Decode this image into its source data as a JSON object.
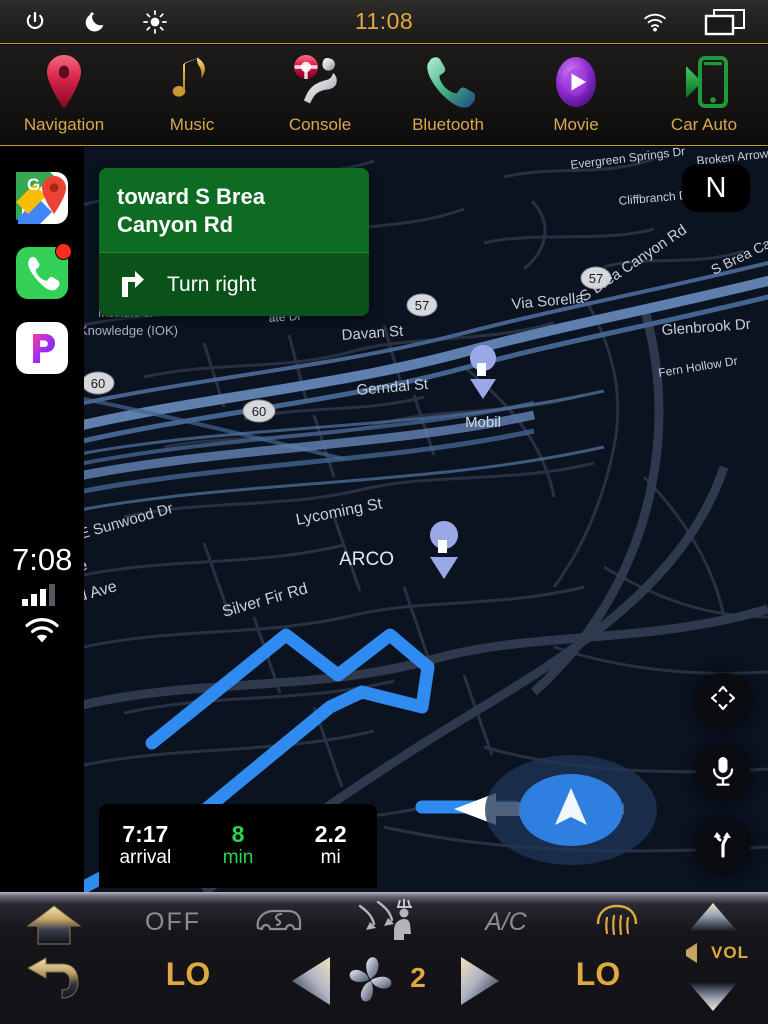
{
  "statusbar": {
    "clock": "11:08",
    "left_icons": [
      {
        "name": "power-icon"
      },
      {
        "name": "night-mode-icon"
      },
      {
        "name": "brightness-icon"
      }
    ],
    "right_icons": [
      {
        "name": "wifi-icon"
      },
      {
        "name": "multi-window-icon"
      }
    ]
  },
  "tabs": [
    {
      "label": "Navigation",
      "icon": "map-pin-icon"
    },
    {
      "label": "Music",
      "icon": "music-note-icon"
    },
    {
      "label": "Console",
      "icon": "steering-wheel-seat-icon"
    },
    {
      "label": "Bluetooth",
      "icon": "phone-handset-icon"
    },
    {
      "label": "Movie",
      "icon": "play-circle-icon"
    },
    {
      "label": "Car Auto",
      "icon": "carplay-phone-icon"
    }
  ],
  "rail": {
    "apps": [
      {
        "name": "google-maps-app",
        "label": "Google Maps"
      },
      {
        "name": "phone-app",
        "label": "Phone",
        "badge": true
      },
      {
        "name": "pandora-app",
        "label": "Pandora"
      }
    ],
    "clock": "7:08",
    "signal_bars": 3,
    "signal_total": 4,
    "wifi": true,
    "home_button": "home-button"
  },
  "navigation": {
    "banner": {
      "destination_line1": "toward S Brea",
      "destination_line2": "Canyon Rd",
      "maneuver": "Turn right",
      "maneuver_icon": "turn-right-arrow-icon",
      "bg_color": "#0e6b22"
    },
    "compass": "N",
    "eta": [
      {
        "value": "7:17",
        "label": "arrival",
        "accent": false
      },
      {
        "value": "8",
        "label": "min",
        "accent": true
      },
      {
        "value": "2.2",
        "label": "mi",
        "accent": false
      }
    ],
    "eta_accent_color": "#28d74b",
    "map_buttons": [
      {
        "name": "recenter-pan-button",
        "icon": "four-way-arrows-icon"
      },
      {
        "name": "voice-search-button",
        "icon": "microphone-icon"
      },
      {
        "name": "route-overview-button",
        "icon": "route-fork-icon"
      }
    ]
  },
  "map": {
    "route_color": "#2f8bf0",
    "background": "#0b1220",
    "road_color": "#2b3546",
    "highway_color": "#5f7fae",
    "street_labels": [
      "Evergreen Springs Dr",
      "Broken Arrow Dr",
      "Cliffbranch Dr",
      "Fern Hollow Dr",
      "S Brea Canyon Rd",
      "Via Sorella",
      "Glenbrook Dr",
      "Davan St",
      "Gerndal St",
      "Lycoming St",
      "E Sunwood Dr",
      "Silver Fir Rd",
      "Knowledge (IOK)",
      "Institute of",
      "wood Ave",
      "mmerwood Ave",
      "on Ave",
      "ate Dr"
    ],
    "highway_shields": [
      "60",
      "60",
      "57",
      "57"
    ],
    "pois": [
      {
        "name": "Mobil",
        "icon": "gas-station-icon"
      },
      {
        "name": "ARCO",
        "icon": "gas-station-icon"
      }
    ],
    "vehicle_marker": "navigation-arrow-icon"
  },
  "climate": {
    "left_nav": [
      {
        "name": "home-hard-button",
        "icon": "home-arrow-icon"
      },
      {
        "name": "back-hard-button",
        "icon": "back-arrow-icon"
      }
    ],
    "fan_mode_label": "OFF",
    "driver_temp": "LO",
    "passenger_temp": "LO",
    "fan_speed": "2",
    "ac_label": "A/C",
    "volume_label": "VOL",
    "indicators": [
      {
        "name": "recirculation-icon",
        "active": false
      },
      {
        "name": "airflow-seat-icon",
        "active": false
      },
      {
        "name": "ac-label",
        "active": false
      },
      {
        "name": "rear-defrost-icon",
        "active": true
      }
    ],
    "accent_color": "#e0a93f",
    "inactive_color": "#8c8c92",
    "fan_decrease": "fan-decrease-button",
    "fan_increase": "fan-increase-button",
    "volume_up": "volume-up-button",
    "volume_down": "volume-down-button"
  }
}
